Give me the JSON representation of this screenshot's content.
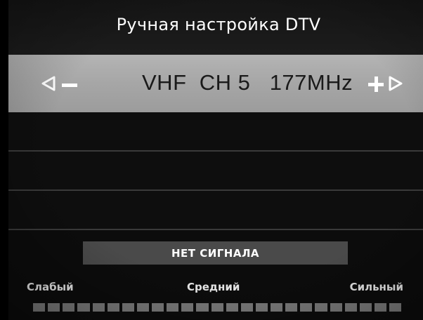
{
  "header": {
    "title": "Ручная настройка DTV"
  },
  "selector": {
    "value_text": "VHF  CH 5   177MHz",
    "left_arrow_icon": "triangle-left-icon",
    "minus_icon": "minus-icon",
    "plus_icon": "plus-icon",
    "right_arrow_icon": "triangle-right-icon",
    "bar_color": "#a8a8a8"
  },
  "status": {
    "text": "НЕТ СИГНАЛА"
  },
  "signal": {
    "label_weak": "Слабый",
    "label_medium": "Средний",
    "label_strong": "Сильный",
    "segment_count": 25,
    "level": 0
  }
}
